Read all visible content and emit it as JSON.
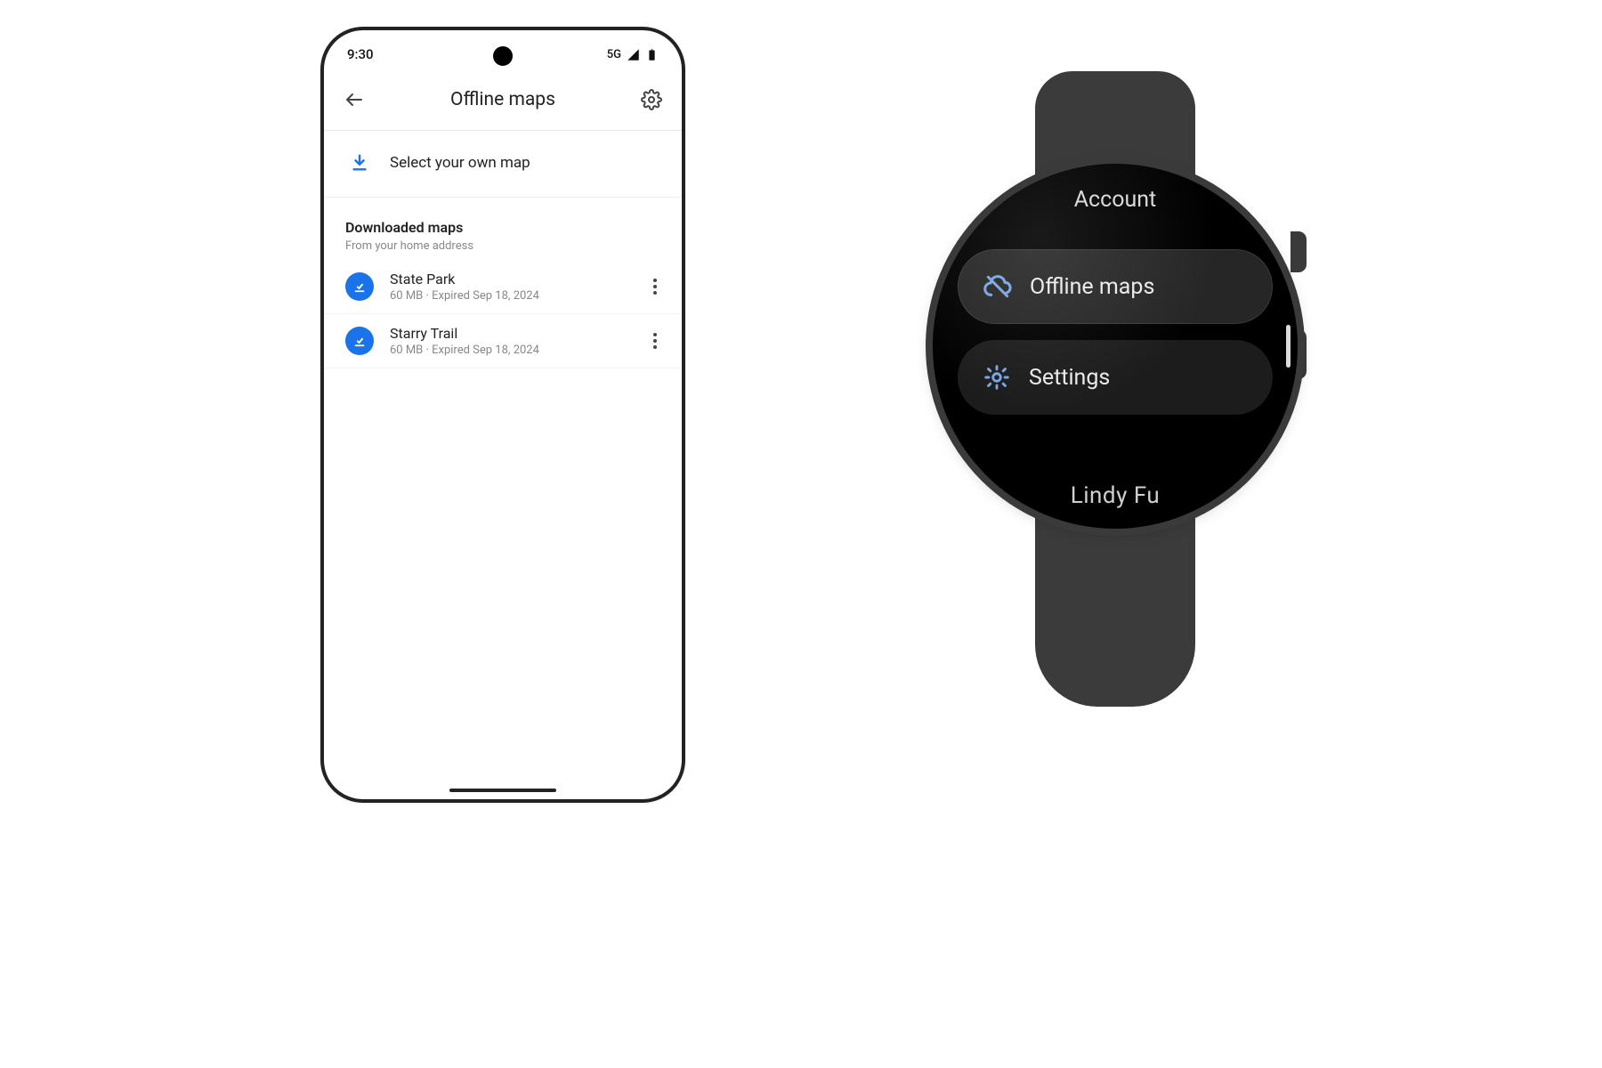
{
  "phone": {
    "status": {
      "time": "9:30",
      "network": "5G"
    },
    "appbar": {
      "title": "Offline maps"
    },
    "select_map_label": "Select your own map",
    "section": {
      "title": "Downloaded maps",
      "subtitle": "From your home address"
    },
    "maps": [
      {
        "name": "State Park",
        "meta": "60 MB · Expired Sep 18, 2024"
      },
      {
        "name": "Starry Trail",
        "meta": "60 MB · Expired Sep 18, 2024"
      }
    ],
    "colors": {
      "accent": "#1a73e8"
    }
  },
  "watch": {
    "header": "Account",
    "items": [
      {
        "icon": "cloud-off",
        "label": "Offline maps"
      },
      {
        "icon": "gear",
        "label": "Settings"
      }
    ],
    "account_name": "Lindy Fu",
    "colors": {
      "icon": "#78a3e4"
    }
  }
}
